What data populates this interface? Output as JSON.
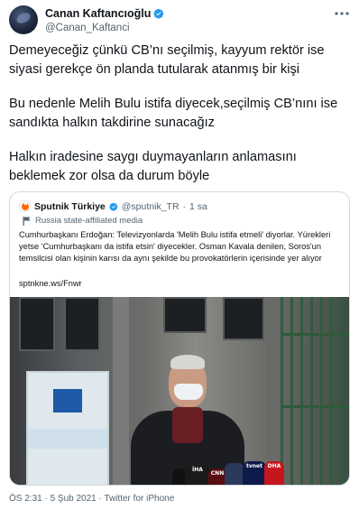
{
  "author": {
    "display_name": "Canan Kaftancıoğlu",
    "handle": "@Canan_Kaftanci",
    "verified": true,
    "avatar_icon": "profile-photo"
  },
  "tweet": {
    "paragraphs": [
      "Demeyeceğiz çünkü CB’nı seçilmiş, kayyum rektör ise siyasi gerekçe ön planda tutularak atanmış bir kişi",
      "Bu nedenle Melih Bulu istifa diyecek,seçilmiş CB’nını ise sandıkta halkın takdirine sunacağız",
      "Halkın iradesine saygı duymayanların anlamasını beklemek zor olsa da durum böyle"
    ]
  },
  "quoted": {
    "display_name": "Sputnik Türkiye",
    "handle": "@sputnik_TR",
    "separator": "·",
    "time": "1 sa",
    "verified": true,
    "label": "Russia state-affiliated media",
    "text": "Cumhurbaşkanı Erdoğan: Televizyonlarda 'Melih Bulu istifa etmeli' diyorlar. Yürekleri yetse 'Cumhurbaşkanı da istifa etsin' diyecekler. Osman Kavala denilen, Soros'un temsilcisi olan kişinin karısı da aynı şekilde bu provokatörlerin içerisinde yer alıyor",
    "link": "sptnkne.ws/Fnwr",
    "mic_labels": [
      "CNN",
      "İHA",
      "tvnet",
      "DHA"
    ]
  },
  "meta": {
    "time": "ÖS 2:31",
    "date": "5 Şub 2021",
    "client": "Twitter for iPhone",
    "line": "ÖS 2:31 · 5 Şub 2021 · Twitter for iPhone"
  },
  "colors": {
    "verified": "#1d9bf0",
    "secondary_text": "#536471",
    "border": "#cfd9de"
  }
}
